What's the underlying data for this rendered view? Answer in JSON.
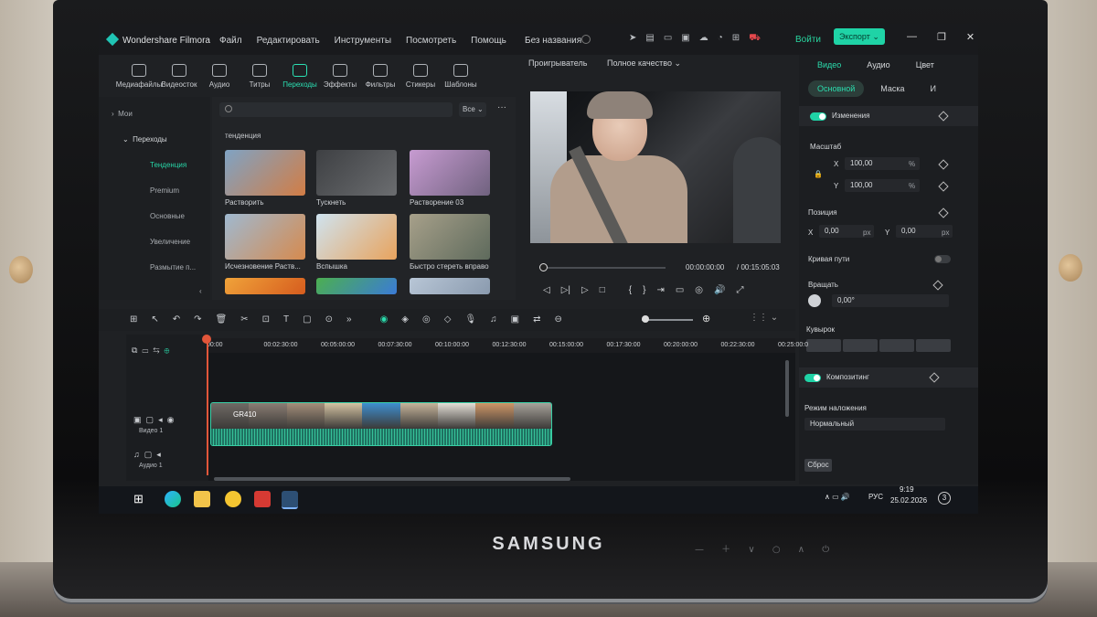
{
  "monitor": {
    "brand": "SAMSUNG",
    "controls": "— ＋ ∨ ○ ∧   ⏻"
  },
  "app": {
    "name": "Wondershare Filmora",
    "menu": [
      "Файл",
      "Редактировать",
      "Инструменты",
      "Посмотреть",
      "Помощь"
    ],
    "doc_title": "Без названия",
    "login": "Войти",
    "export": "Экспорт ⌄",
    "window_controls": [
      "—",
      "❐",
      "✕"
    ]
  },
  "media_tabs": [
    {
      "label": "Медиафайлы",
      "icon": "media-icon"
    },
    {
      "label": "Видеосток",
      "icon": "stock-icon"
    },
    {
      "label": "Аудио",
      "icon": "music-icon"
    },
    {
      "label": "Титры",
      "icon": "titles-icon"
    },
    {
      "label": "Переходы",
      "icon": "transitions-icon",
      "active": true
    },
    {
      "label": "Эффекты",
      "icon": "effects-icon"
    },
    {
      "label": "Фильтры",
      "icon": "filters-icon"
    },
    {
      "label": "Стикеры",
      "icon": "stickers-icon"
    },
    {
      "label": "Шаблоны",
      "icon": "templates-icon"
    }
  ],
  "sidebar": {
    "mine": "Мои",
    "transitions": "Переходы",
    "items": [
      "Тенденция",
      "Premium",
      "Основные",
      "Увеличение",
      "Размытие п..."
    ]
  },
  "browser": {
    "filter": "Все ⌄",
    "more": "···",
    "section": "тенденция",
    "cards": [
      {
        "label": "Растворить",
        "colors": [
          "#7fa3c4",
          "#d27d45"
        ]
      },
      {
        "label": "Тускнеть",
        "colors": [
          "#3e4043",
          "#6b6d70"
        ]
      },
      {
        "label": "Растворение 03",
        "colors": [
          "#c79bd1",
          "#70627f"
        ]
      },
      {
        "label": "Исчезновение Раств...",
        "colors": [
          "#9fb9d0",
          "#d68a4e"
        ]
      },
      {
        "label": "Вспышка",
        "colors": [
          "#cfe3ef",
          "#e8a35d"
        ]
      },
      {
        "label": "Быстро стереть вправо",
        "colors": [
          "#a7a08a",
          "#5e6a5c"
        ]
      },
      {
        "label": "",
        "colors": [
          "#f0a33a",
          "#d65c1e"
        ]
      },
      {
        "label": "",
        "colors": [
          "#4caf50",
          "#3b7bd6"
        ]
      },
      {
        "label": "",
        "colors": [
          "#b8c6d6",
          "#8a9aae"
        ]
      }
    ]
  },
  "player": {
    "label": "Проигрыватель",
    "quality": "Полное качество ⌄",
    "current_time": "00:00:00:00",
    "total_time": "/ 00:15:05:03",
    "controls": [
      "◁",
      "▷|",
      "▷",
      "□",
      "{",
      "}",
      "⇥",
      "▭",
      "◎",
      "🔊",
      "⤢"
    ]
  },
  "inspector": {
    "tabs": [
      "Видео",
      "Аудио",
      "Цвет"
    ],
    "subtabs": [
      "Основной",
      "Маска",
      "И"
    ],
    "changes": "Изменения",
    "scale": "Масштаб",
    "scale_x": "100,00",
    "scale_y": "100,00",
    "percent": "%",
    "position": "Позиция",
    "pos_x": "0,00",
    "pos_y": "0,00",
    "px": "px",
    "motion_path": "Кривая пути",
    "rotate": "Вращать",
    "rotate_value": "0,00°",
    "flip": "Кувырок",
    "compositing": "Композитинг",
    "blend_mode_label": "Режим наложения",
    "blend_mode": "Нормальный",
    "reset": "Сброс",
    "axis_x": "X",
    "axis_y": "Y"
  },
  "timeline": {
    "ruler": [
      "00:00",
      "00:02:30:00",
      "00:05:00:00",
      "00:07:30:00",
      "00:10:00:00",
      "00:12:30:00",
      "00:15:00:00",
      "00:17:30:00",
      "00:20:00:00",
      "00:22:30:00",
      "00:25:00:0"
    ],
    "video_track": "Видео 1",
    "audio_track": "Аудио 1",
    "clip_label": "GR410",
    "toolbar": [
      "⊞",
      "↖",
      "↶",
      "↷",
      "🗑",
      "✂",
      "⊡",
      "T",
      "▢",
      "⊙",
      "»",
      "◉",
      "◈",
      "◎",
      "◇",
      "🎙",
      "♫",
      "▣",
      "⇄",
      "⊖"
    ]
  },
  "taskbar": {
    "lang": "РУС",
    "time": "9:19",
    "date": "25.02.2026",
    "notif": "3",
    "tray_icons": "∧ ▭ 🔊"
  }
}
